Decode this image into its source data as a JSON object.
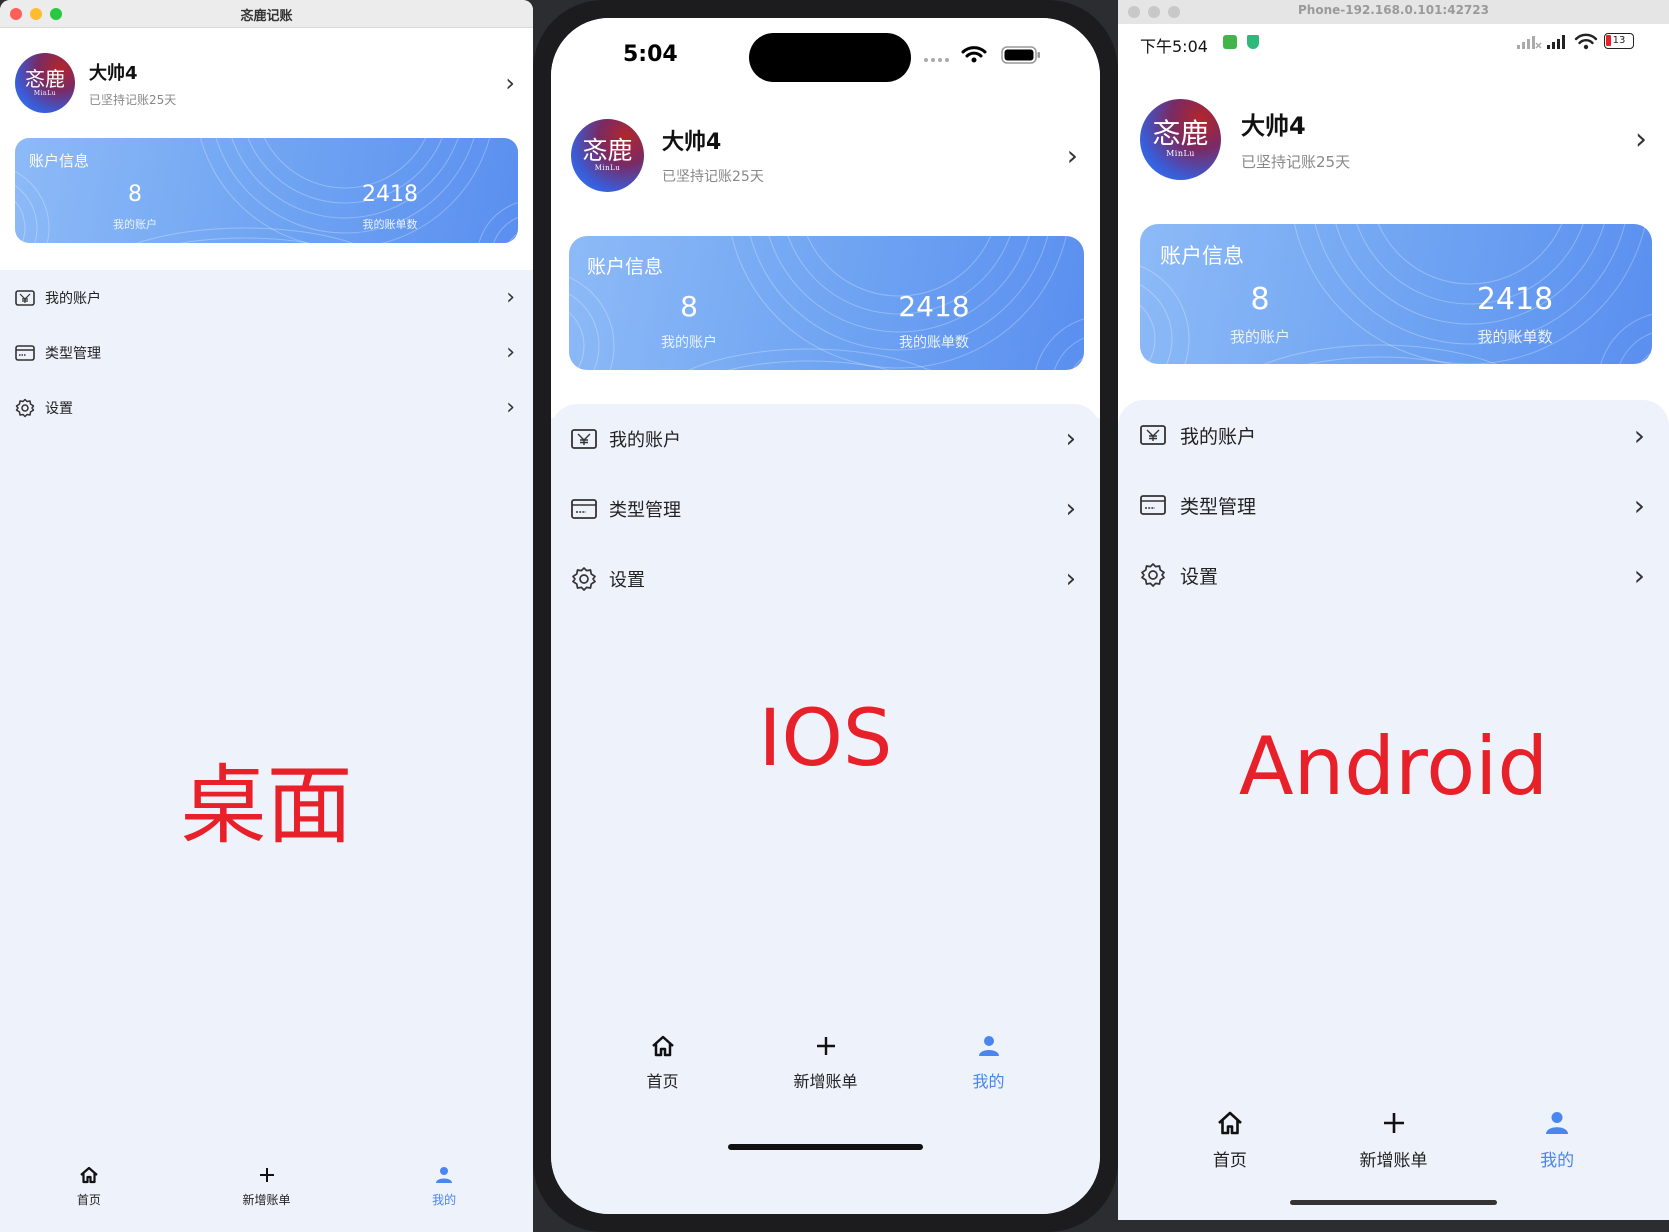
{
  "app": {
    "window_title": "忞鹿记账",
    "avatar_big": "忞鹿",
    "avatar_small": "MinLu",
    "user_name": "大帅4",
    "streak": "已坚持记账25天",
    "card_title": "账户信息",
    "accounts_count": "8",
    "accounts_label": "我的账户",
    "bills_count": "2418",
    "bills_label": "我的账单数",
    "menu": [
      {
        "label": "我的账户",
        "icon": "yen-wallet-icon"
      },
      {
        "label": "类型管理",
        "icon": "card-icon"
      },
      {
        "label": "设置",
        "icon": "gear-icon"
      }
    ],
    "tabs": [
      {
        "label": "首页",
        "icon": "home-icon",
        "active": false
      },
      {
        "label": "新增账单",
        "icon": "plus-icon",
        "active": false
      },
      {
        "label": "我的",
        "icon": "user-icon",
        "active": true
      }
    ],
    "chevron": "›"
  },
  "platform_labels": {
    "desktop": "桌面",
    "ios": "IOS",
    "android": "Android"
  },
  "ios_status": {
    "time": "5:04"
  },
  "android_status": {
    "window_title": "Phone-192.168.0.101:42723",
    "time": "下午5:04",
    "battery": "13"
  },
  "colors": {
    "accent": "#4a86ef",
    "platform_label": "#e8202a",
    "background": "#eef2fb"
  }
}
